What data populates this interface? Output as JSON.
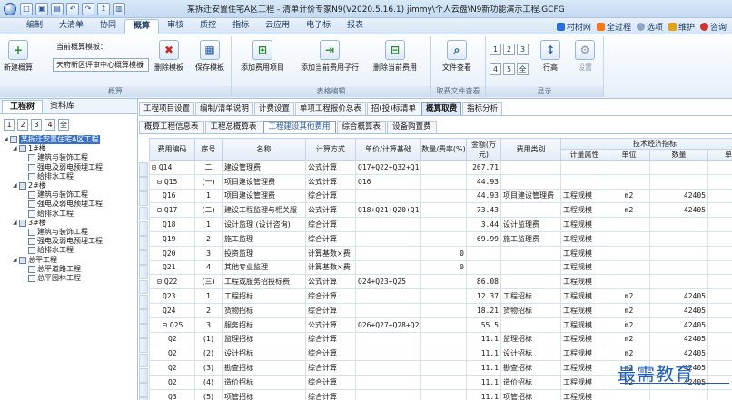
{
  "window": {
    "title": "某拆迁安置住宅A区工程 - 清单计价专家N9(V2020.5.16.1) jimmy\\个人云盘\\N9新功能演示工程.GCFG"
  },
  "menu": {
    "items": [
      "编制",
      "大清单",
      "协同",
      "概算",
      "审核",
      "质控",
      "指标",
      "云应用",
      "电子标",
      "报表"
    ],
    "active": "概算",
    "right": [
      "村树网",
      "全过程",
      "选项",
      "维护",
      "咨询"
    ]
  },
  "ribbon": {
    "groups": [
      "概算",
      "表格编辑",
      "取费文件查看",
      "显示"
    ],
    "current_template_label": "当前概算模板：",
    "template_value": "天府新区评审中心概算模板",
    "buttons": {
      "new_budget": "新建概算",
      "delete_template": "删除模板",
      "save_template": "保存模板",
      "add_fee_item": "添加费用项目",
      "add_child": "添加当前费用子行",
      "delete_fee": "删除当前费用",
      "view_file": "文件查看",
      "row": "行高",
      "settings": "设置"
    },
    "nums_top": [
      "1",
      "2",
      "3"
    ],
    "nums_bottom": [
      "4",
      "5",
      "全"
    ]
  },
  "left_panel": {
    "tabs": [
      "工程树",
      "资料库"
    ],
    "nums": [
      "1",
      "2",
      "3",
      "4",
      "全"
    ],
    "tree": [
      {
        "label": "某拆迁安置住宅A区工程",
        "level": 0,
        "selected": true
      },
      {
        "label": "1#楼",
        "level": 1
      },
      {
        "label": "建筑与装饰工程",
        "level": 2
      },
      {
        "label": "强电及弱电预埋工程",
        "level": 2
      },
      {
        "label": "给排水工程",
        "level": 2
      },
      {
        "label": "2#楼",
        "level": 1
      },
      {
        "label": "建筑与装饰工程",
        "level": 2
      },
      {
        "label": "强电及弱电预埋工程",
        "level": 2
      },
      {
        "label": "给排水工程",
        "level": 2
      },
      {
        "label": "3#楼",
        "level": 1
      },
      {
        "label": "建筑与装饰工程",
        "level": 2
      },
      {
        "label": "强电及弱电预埋工程",
        "level": 2
      },
      {
        "label": "给排水工程",
        "level": 2
      },
      {
        "label": "总平工程",
        "level": 1
      },
      {
        "label": "总平道路工程",
        "level": 2
      },
      {
        "label": "总平园林工程",
        "level": 2
      }
    ]
  },
  "tabs_top": [
    "工程项目设置",
    "编制/清单说明",
    "计费设置",
    "单项工程报价总表",
    "招(投)标清单",
    "概算取费",
    "指标分析"
  ],
  "tabs_top_active": "概算取费",
  "tabs_sub": [
    "概算工程信息表",
    "工程总概算表",
    "工程建设其他费用",
    "综合概算表",
    "设备购置费"
  ],
  "tabs_sub_active": "工程建设其他费用",
  "table": {
    "headers": [
      "费用编码",
      "序号",
      "名称",
      "计算方式",
      "单价/计算基础",
      "数量/费率(%)",
      "金额(万元)",
      "费用类别",
      "计量属性",
      "单位",
      "数量"
    ],
    "group_header": "技术经济指标",
    "rows": [
      {
        "code": "Q14",
        "no": "二",
        "name": "建设管理费",
        "method": "公式计算",
        "base": "Q17+Q22+Q32+Q15",
        "qty": "",
        "amount": "267.71",
        "cat": "",
        "attr": "",
        "unit": "",
        "num": "",
        "expand": "⊟",
        "indent": 0
      },
      {
        "code": "Q15",
        "no": "(一)",
        "name": "项目建设管理费",
        "method": "公式计算",
        "base": "Q16",
        "qty": "",
        "amount": "44.93",
        "cat": "",
        "attr": "",
        "unit": "",
        "num": "",
        "expand": "⊟",
        "indent": 1
      },
      {
        "code": "Q16",
        "no": "1",
        "name": "项目建设管理费",
        "method": "综合计算",
        "base": "",
        "qty": "",
        "amount": "44.93",
        "cat": "项目建设管理费",
        "attr": "工程规模",
        "unit": "m2",
        "num": "42405",
        "expand": "",
        "indent": 2
      },
      {
        "code": "Q17",
        "no": "(二)",
        "name": "建设工程监理与相关服",
        "method": "公式计算",
        "base": "Q18+Q21+Q20+Q19",
        "qty": "",
        "amount": "73.43",
        "cat": "",
        "attr": "工程规模",
        "unit": "m2",
        "num": "42405",
        "expand": "⊟",
        "indent": 1
      },
      {
        "code": "Q18",
        "no": "1",
        "name": "设计监理 (设计咨询)",
        "method": "综合计算",
        "base": "",
        "qty": "",
        "amount": "3.44",
        "cat": "设计监理费",
        "attr": "工程规模",
        "unit": "",
        "num": "",
        "expand": "",
        "indent": 2
      },
      {
        "code": "Q19",
        "no": "2",
        "name": "施工监理",
        "method": "综合计算",
        "base": "",
        "qty": "",
        "amount": "69.99",
        "cat": "施工监理费",
        "attr": "工程规模",
        "unit": "",
        "num": "",
        "expand": "",
        "indent": 2
      },
      {
        "code": "Q20",
        "no": "3",
        "name": "投资监理",
        "method": "计算基数×费",
        "base": "",
        "qty": "0",
        "amount": "",
        "cat": "",
        "attr": "工程规模",
        "unit": "",
        "num": "",
        "expand": "",
        "indent": 2
      },
      {
        "code": "Q21",
        "no": "4",
        "name": "其他专业监理",
        "method": "计算基数×费",
        "base": "",
        "qty": "0",
        "amount": "",
        "cat": "",
        "attr": "工程规模",
        "unit": "",
        "num": "",
        "expand": "",
        "indent": 2
      },
      {
        "code": "Q22",
        "no": "(三)",
        "name": "工程或服务招投标费",
        "method": "公式计算",
        "base": "Q24+Q23+Q25",
        "qty": "",
        "amount": "86.08",
        "cat": "",
        "attr": "工程规模",
        "unit": "",
        "num": "",
        "expand": "⊟",
        "indent": 1
      },
      {
        "code": "Q23",
        "no": "1",
        "name": "工程招标",
        "method": "综合计算",
        "base": "",
        "qty": "",
        "amount": "12.37",
        "cat": "工程招标",
        "attr": "工程规模",
        "unit": "m2",
        "num": "42405",
        "expand": "",
        "indent": 2
      },
      {
        "code": "Q24",
        "no": "2",
        "name": "货物招标",
        "method": "综合计算",
        "base": "",
        "qty": "",
        "amount": "18.21",
        "cat": "货物招标",
        "attr": "工程规模",
        "unit": "m2",
        "num": "42405",
        "expand": "",
        "indent": 2
      },
      {
        "code": "Q25",
        "no": "3",
        "name": "服务招标",
        "method": "公式计算",
        "base": "Q26+Q27+Q28+Q29",
        "qty": "",
        "amount": "55.5",
        "cat": "",
        "attr": "工程规模",
        "unit": "m2",
        "num": "42405",
        "expand": "⊟",
        "indent": 2
      },
      {
        "code": "Q2",
        "no": "(1)",
        "name": "监理招标",
        "method": "综合计算",
        "base": "",
        "qty": "",
        "amount": "11.1",
        "cat": "监理招标",
        "attr": "工程规模",
        "unit": "m2",
        "num": "42405",
        "expand": "",
        "indent": 3
      },
      {
        "code": "Q2",
        "no": "(2)",
        "name": "设计招标",
        "method": "综合计算",
        "base": "",
        "qty": "",
        "amount": "11.1",
        "cat": "设计招标",
        "attr": "工程规模",
        "unit": "m2",
        "num": "42405",
        "expand": "",
        "indent": 3
      },
      {
        "code": "Q2",
        "no": "(3)",
        "name": "勘查招标",
        "method": "综合计算",
        "base": "",
        "qty": "",
        "amount": "11.1",
        "cat": "勘查招标",
        "attr": "工程规模",
        "unit": "m2",
        "num": "42405",
        "expand": "",
        "indent": 3
      },
      {
        "code": "Q2",
        "no": "(4)",
        "name": "造价招标",
        "method": "综合计算",
        "base": "",
        "qty": "",
        "amount": "11.1",
        "cat": "造价招标",
        "attr": "工程规模",
        "unit": "m2",
        "num": "42405",
        "expand": "",
        "indent": 3
      },
      {
        "code": "Q3",
        "no": "(5)",
        "name": "项管招标",
        "method": "综合计算",
        "base": "",
        "qty": "",
        "amount": "11.1",
        "cat": "项管招标",
        "attr": "工程规模",
        "unit": "",
        "num": "",
        "expand": "",
        "indent": 3
      }
    ]
  },
  "watermark": "最需教育",
  "colors": {
    "accent": "#3a73c5",
    "ribbon_border": "#a9c3e3",
    "watermark": "#1d5fb8"
  }
}
